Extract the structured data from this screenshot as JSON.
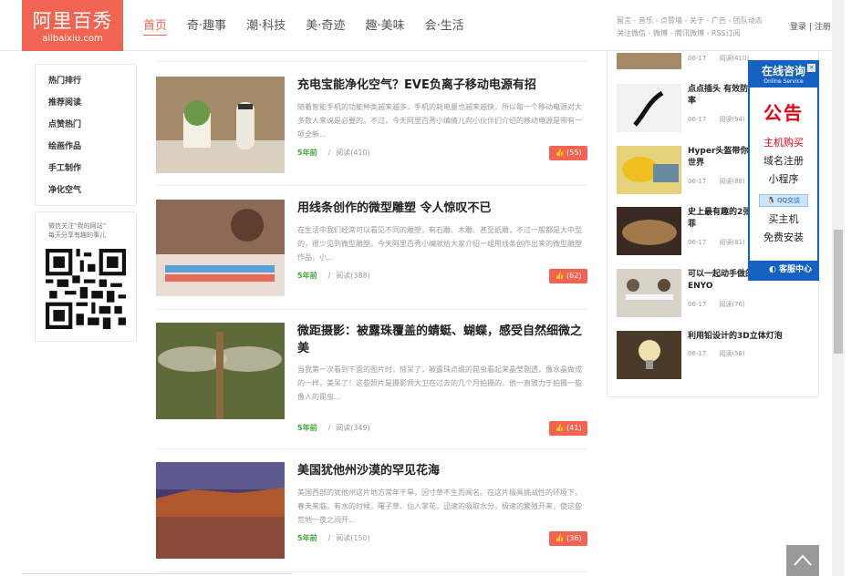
{
  "brand": {
    "logo_cn": "阿里百秀",
    "logo_en": "alibaixiu.com",
    "accent": "#f06451"
  },
  "nav": [
    "首页",
    "奇·趣事",
    "潮·科技",
    "美·奇迹",
    "趣·美味",
    "会·生活"
  ],
  "top_links": [
    "留言 - 音乐 - 点赞墙 - 关于 - 广告 - 团队动态",
    "关注微信 - 微博 - 腾讯微博 - RSS订阅"
  ],
  "account": {
    "login": "登录",
    "sep": "|",
    "register": "注册"
  },
  "categories": [
    "热门排行",
    "推荐阅读",
    "点赞热门",
    "绘画作品",
    "手工制作",
    "净化空气"
  ],
  "wechat": {
    "line1": "微信关注“我的网站”",
    "line2": "每天分享有趣的事儿"
  },
  "articles": [
    {
      "title": "充电宝能净化空气？EVE负离子移动电源有招",
      "desc": "随着智能手机的功能种类越来越多，手机的耗电量也越来越快，所以每一个移动电源对大多数人来说是必要的。不过，今天阿里百秀小编倩儿向小伙伴们介绍的移动电源是带有一项全新...",
      "time": "5年前",
      "reads": "阅读(410)",
      "likes": "(55)"
    },
    {
      "title": "用线条创作的微型雕塑 令人惊叹不已",
      "desc": "在生活中我们经常可以看见不同的雕塑，有石雕、木雕、甚至纸雕，不过一般都是大中型的，很少见到微型雕塑。今天阿里百秀小编就给大家介绍一组用线条创作出来的微型雕塑作品，小...",
      "time": "5年前",
      "reads": "阅读(388)",
      "likes": "(62)"
    },
    {
      "title": "微距摄影：被露珠覆盖的蜻蜓、蝴蝶，感受自然细微之美",
      "desc": "当我第一次看到下面的图片时，惊呆了，被露珠点缀的昆虫看起来晶莹剔透，像水晶做成的一样，美呆了！这些照片是摄影师大卫在过去的几个月拍摄的，他一直致力于拍摄一些像人的昆虫...",
      "time": "5年前",
      "reads": "阅读(349)",
      "likes": "(41)"
    },
    {
      "title": "美国犹他州沙漠的罕见花海",
      "desc": "美国西部的犹他州这片地方常年干旱，因寸草不生而闻名。在这片极具挑战性的环境下，春天来临，有水的时候，曙子草、仙人掌花，迅速的吸取水分，极速的繁殖开来，使这些荒地一夜之间开...",
      "time": "5年前",
      "reads": "阅读(150)",
      "likes": "(36)"
    }
  ],
  "side_list": [
    {
      "title": "",
      "date": "06-17",
      "reads": "阅读(410)"
    },
    {
      "title": "点点插头 有效防止用电安全隐患率",
      "date": "06-17",
      "reads": "阅读(94)"
    },
    {
      "title": "Hyper头盔带你进入虚拟世界新世界",
      "date": "06-17",
      "reads": "阅读(88)"
    },
    {
      "title": "史上最有趣的2张桌子，价值不菲",
      "date": "06-17",
      "reads": "阅读(81)"
    },
    {
      "title": "可以一起动手做的智能桌子 ENYO",
      "date": "06-17",
      "reads": "阅读(76)"
    },
    {
      "title": "利用铅设计的3D立体灯泡",
      "date": "06-17",
      "reads": "阅读(58)"
    }
  ],
  "consult": {
    "title": "在线咨询",
    "subtitle": "Online Service",
    "close": "×",
    "notice": "公告",
    "line1": "主机购买",
    "line2": "域名注册",
    "line3": "小程序",
    "qq": "QQ交谈",
    "line4": "买主机",
    "line5": "免费安装",
    "footer": "客服中心",
    "blue": "#1662c2",
    "red": "#e60012"
  }
}
